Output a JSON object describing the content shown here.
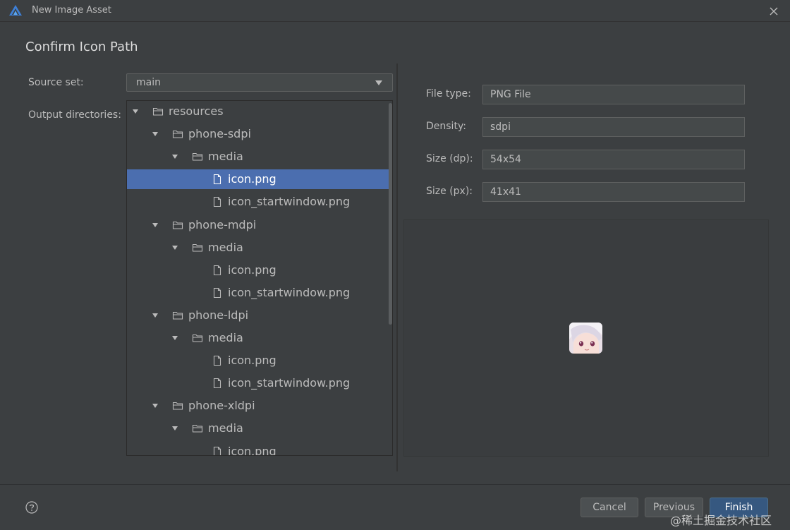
{
  "window": {
    "title": "New Image Asset"
  },
  "step_title": "Confirm Icon Path",
  "source_set": {
    "label": "Source set:",
    "value": "main"
  },
  "output": {
    "label": "Output directories:",
    "tree": [
      {
        "label": "resources",
        "type": "folder",
        "expanded": true
      },
      {
        "label": "phone-sdpi",
        "type": "folder",
        "expanded": true
      },
      {
        "label": "media",
        "type": "folder",
        "expanded": true
      },
      {
        "label": "icon.png",
        "type": "file",
        "selected": true
      },
      {
        "label": "icon_startwindow.png",
        "type": "file"
      },
      {
        "label": "phone-mdpi",
        "type": "folder",
        "expanded": true
      },
      {
        "label": "media",
        "type": "folder",
        "expanded": true
      },
      {
        "label": "icon.png",
        "type": "file"
      },
      {
        "label": "icon_startwindow.png",
        "type": "file"
      },
      {
        "label": "phone-ldpi",
        "type": "folder",
        "expanded": true
      },
      {
        "label": "media",
        "type": "folder",
        "expanded": true
      },
      {
        "label": "icon.png",
        "type": "file"
      },
      {
        "label": "icon_startwindow.png",
        "type": "file"
      },
      {
        "label": "phone-xldpi",
        "type": "folder",
        "expanded": true
      },
      {
        "label": "media",
        "type": "folder",
        "expanded": true
      },
      {
        "label": "icon.png",
        "type": "file"
      }
    ]
  },
  "details": {
    "file_type": {
      "label": "File type:",
      "value": "PNG File"
    },
    "density": {
      "label": "Density:",
      "value": "sdpi"
    },
    "size_dp": {
      "label": "Size (dp):",
      "value": "54x54"
    },
    "size_px": {
      "label": "Size (px):",
      "value": "41x41"
    }
  },
  "buttons": {
    "cancel": "Cancel",
    "previous": "Previous",
    "finish": "Finish"
  },
  "watermark": "@稀土掘金技术社区",
  "colors": {
    "background": "#3c3f41",
    "selection": "#4b6eaf",
    "primary_button": "#365880",
    "text": "#bbbbbb"
  },
  "icons": [
    "app-logo-icon",
    "close-icon",
    "chevron-down-icon",
    "folder-icon",
    "file-icon",
    "help-icon"
  ]
}
